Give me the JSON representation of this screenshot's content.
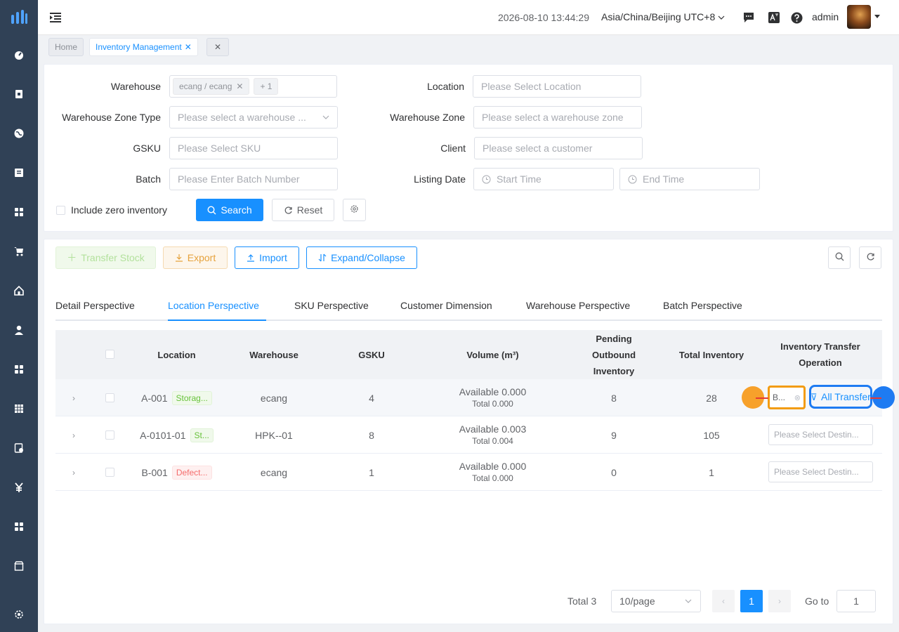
{
  "sidebar": {
    "icons": [
      "logo-icon",
      "dashboard-icon",
      "order-icon",
      "globe-icon",
      "document-icon",
      "grid-icon",
      "cart-icon",
      "home-icon",
      "user-icon",
      "apps-icon",
      "table-icon",
      "finance-doc-icon",
      "yuan-icon",
      "modules-icon",
      "store-icon",
      "settings-icon"
    ]
  },
  "header": {
    "datetime": "2026-08-10 13:44:29",
    "timezone": "Asia/China/Beijing UTC+8",
    "user": "admin"
  },
  "tags": {
    "home": "Home",
    "active": "Inventory Management"
  },
  "filters": {
    "warehouse": {
      "label": "Warehouse",
      "chip": "ecang / ecang",
      "more": "+ 1"
    },
    "location": {
      "label": "Location",
      "placeholder": "Please Select Location"
    },
    "zone_type": {
      "label": "Warehouse Zone Type",
      "placeholder": "Please select a warehouse ..."
    },
    "zone": {
      "label": "Warehouse Zone",
      "placeholder": "Please select a warehouse zone"
    },
    "gsku": {
      "label": "GSKU",
      "placeholder": "Please Select SKU"
    },
    "client": {
      "label": "Client",
      "placeholder": "Please select a customer"
    },
    "batch": {
      "label": "Batch",
      "placeholder": "Please Enter Batch Number"
    },
    "listing_date": {
      "label": "Listing Date",
      "start": "Start Time",
      "end": "End Time"
    },
    "include_zero": "Include zero inventory",
    "search": "Search",
    "reset": "Reset"
  },
  "toolbar": {
    "transfer": "Transfer Stock",
    "export": "Export",
    "import": "Import",
    "expand": "Expand/Collapse"
  },
  "tabs": [
    "Detail Perspective",
    "Location Perspective",
    "SKU Perspective",
    "Customer Dimension",
    "Warehouse Perspective",
    "Batch Perspective"
  ],
  "table": {
    "headers": {
      "location": "Location",
      "warehouse": "Warehouse",
      "gsku": "GSKU",
      "volume": "Volume (m³)",
      "pending": "Pending Outbound Inventory",
      "total": "Total Inventory",
      "operation": "Inventory Transfer Operation"
    },
    "rows": [
      {
        "location": "A-001",
        "tag": "Storag...",
        "tag_color": "green",
        "warehouse": "ecang",
        "gsku": "4",
        "available": "Available 0.000",
        "vol_total": "Total 0.000",
        "pending": "8",
        "total": "28",
        "dest": "B...",
        "all_transfer": "All Transfer"
      },
      {
        "location": "A-0101-01",
        "tag": "St...",
        "tag_color": "green",
        "warehouse": "HPK--01",
        "gsku": "8",
        "available": "Available 0.003",
        "vol_total": "Total 0.004",
        "pending": "9",
        "total": "105",
        "dest": "Please Select Destin..."
      },
      {
        "location": "B-001",
        "tag": "Defect...",
        "tag_color": "red",
        "warehouse": "ecang",
        "gsku": "1",
        "available": "Available 0.000",
        "vol_total": "Total 0.000",
        "pending": "0",
        "total": "1",
        "dest": "Please Select Destin..."
      }
    ]
  },
  "pagination": {
    "total": "Total 3",
    "page_size": "10/page",
    "current": "1",
    "goto_label": "Go to",
    "goto_value": "1"
  },
  "colors": {
    "primary": "#1890ff",
    "sidebar": "#304156",
    "highlight_orange": "#f39c12",
    "highlight_blue": "#1e7bf2"
  }
}
